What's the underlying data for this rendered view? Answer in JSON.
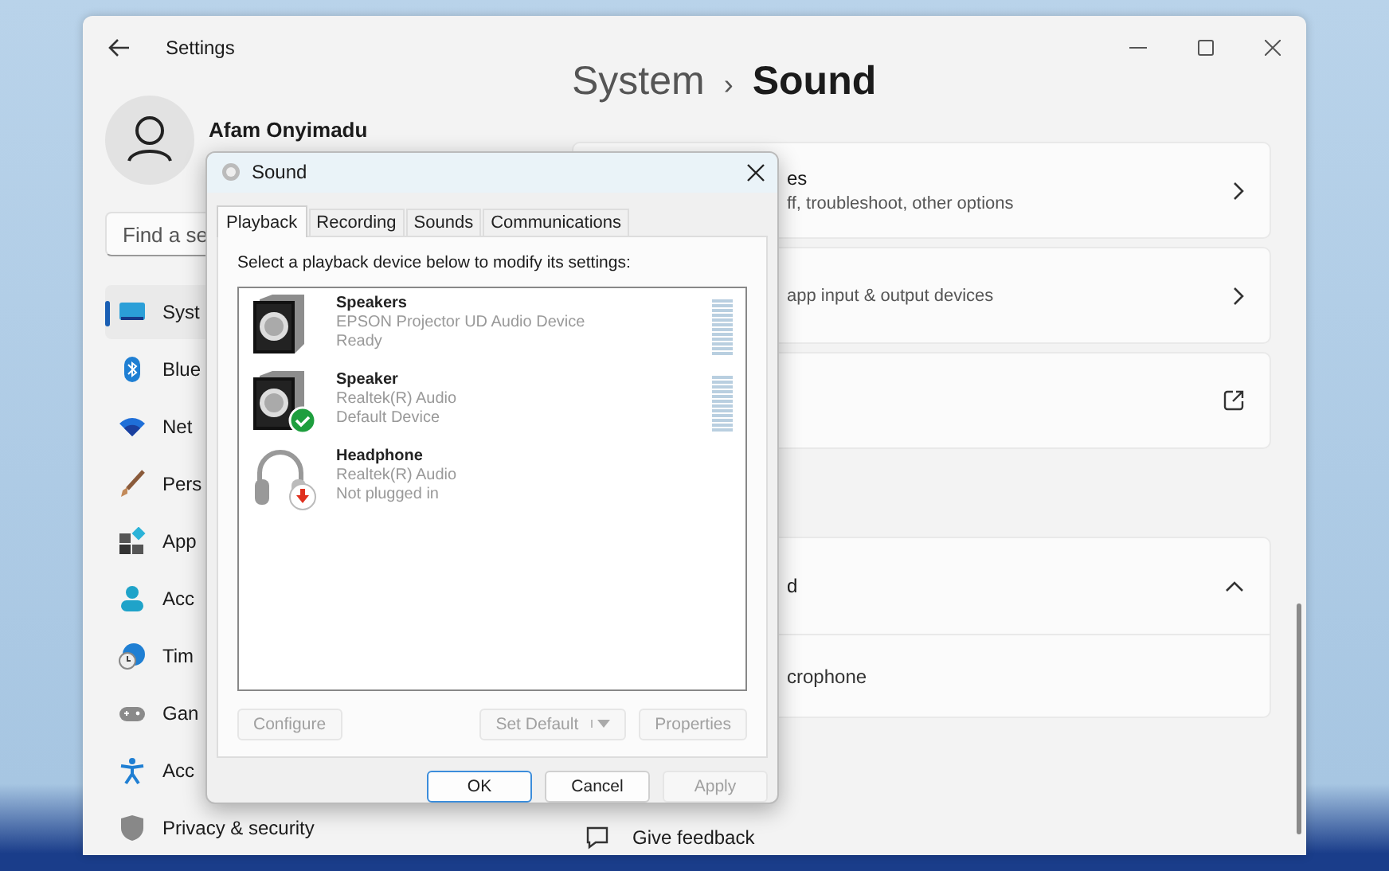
{
  "settings_window": {
    "title": "Settings",
    "user": {
      "name": "Afam Onyimadu"
    },
    "search": {
      "placeholder": "Find a se"
    },
    "nav": [
      {
        "label": "Syst",
        "kind": "system",
        "selected": true
      },
      {
        "label": "Blue",
        "kind": "bluetooth",
        "selected": false
      },
      {
        "label": "Net",
        "kind": "network",
        "selected": false
      },
      {
        "label": "Pers",
        "kind": "brush",
        "selected": false
      },
      {
        "label": "App",
        "kind": "apps",
        "selected": false
      },
      {
        "label": "Acc",
        "kind": "accounts",
        "selected": false
      },
      {
        "label": "Tim",
        "kind": "time",
        "selected": false
      },
      {
        "label": "Gan",
        "kind": "gaming",
        "selected": false
      },
      {
        "label": "Acc",
        "kind": "accessibility",
        "selected": false
      },
      {
        "label": "Privacy & security",
        "kind": "privacy",
        "selected": false
      }
    ],
    "breadcrumb": {
      "parent": "System",
      "separator": "›",
      "current": "Sound"
    },
    "cards": [
      {
        "kind": "chevron",
        "title": "es",
        "subtitle": "ff, troubleshoot, other options"
      },
      {
        "kind": "chevron",
        "subtitle": "app input & output devices"
      },
      {
        "kind": "external"
      },
      {
        "kind": "expander",
        "title": "d",
        "expanded": true,
        "children": [
          {
            "title": "crophone"
          }
        ]
      }
    ],
    "footer_links": [
      "Give feedback"
    ]
  },
  "sound_dialog": {
    "title": "Sound",
    "tabs": [
      {
        "label": "Playback",
        "selected": true
      },
      {
        "label": "Recording",
        "selected": false
      },
      {
        "label": "Sounds",
        "selected": false
      },
      {
        "label": "Communications",
        "selected": false
      }
    ],
    "instruction": "Select a playback device below to modify its settings:",
    "devices": [
      {
        "name": "Speakers",
        "driver": "EPSON Projector UD Audio Device",
        "status": "Ready",
        "kind": "speaker",
        "default": false,
        "plugged_in": true,
        "meter": true
      },
      {
        "name": "Speaker",
        "driver": "Realtek(R) Audio",
        "status": "Default Device",
        "kind": "speaker",
        "default": true,
        "plugged_in": true,
        "meter": true
      },
      {
        "name": "Headphone",
        "driver": "Realtek(R) Audio",
        "status": "Not plugged in",
        "kind": "headphone",
        "default": false,
        "plugged_in": false,
        "meter": false
      }
    ],
    "device_buttons": [
      {
        "label": "Configure",
        "disabled": true,
        "dropdown": false
      },
      {
        "label": "Set Default",
        "disabled": true,
        "dropdown": true
      },
      {
        "label": "Properties",
        "disabled": true,
        "dropdown": false
      }
    ],
    "footer_buttons": [
      {
        "label": "OK",
        "default": true,
        "disabled": false
      },
      {
        "label": "Cancel",
        "default": false,
        "disabled": false
      },
      {
        "label": "Apply",
        "default": false,
        "disabled": true
      }
    ]
  }
}
